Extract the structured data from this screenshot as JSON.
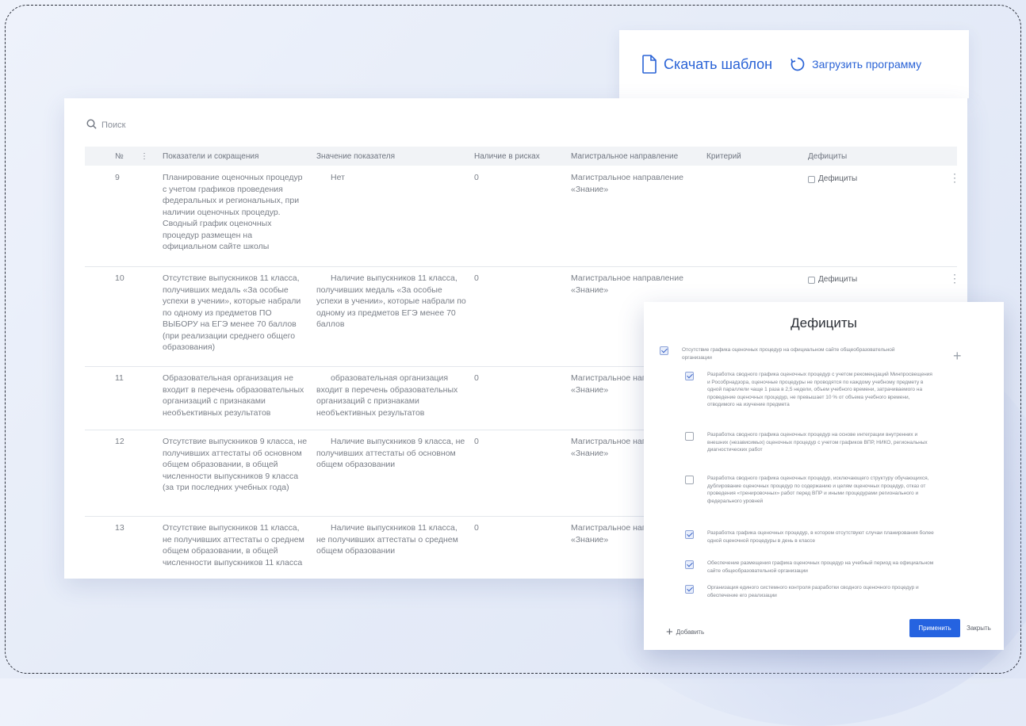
{
  "actions": {
    "download_template": "Скачать шаблон",
    "upload_program": "Загрузить программу"
  },
  "search": {
    "placeholder": "Поиск"
  },
  "table": {
    "headers": {
      "num": "№",
      "indicators": "Показатели и сокращения",
      "value": "Значение показателя",
      "points": "Наличие в рисках",
      "direction": "Магистральное направление",
      "criterion": "Критерий",
      "deficits": "Дефициты"
    },
    "rows": [
      {
        "num": "9",
        "indicator": "Планирование оценочных процедур с учетом графиков проведения федеральных и региональных, при наличии оценочных процедур. Сводный график оценочных процедур размещен на официальном сайте школы",
        "value": "Нет",
        "points": "0",
        "direction": "Магистральное направление «Знание»",
        "deficits_label": "Дефициты"
      },
      {
        "num": "10",
        "indicator": "Отсутствие выпускников 11 класса, получивших медаль «За особые успехи в учении», которые набрали по одному из предметов ПО ВЫБОРУ на ЕГЭ менее 70 баллов (при реализации среднего общего образования)",
        "value": "Наличие выпускников 11 класса, получивших медаль «За особые успехи в учении», которые набрали по одному из предметов ЕГЭ менее 70 баллов",
        "points": "0",
        "direction": "Магистральное направление «Знание»",
        "deficits_label": "Дефициты"
      },
      {
        "num": "11",
        "indicator": "Образовательная организация не входит в перечень образовательных организаций с признаками необъективных результатов",
        "value": "образовательная организация входит в перечень образовательных организаций с признаками необъективных результатов",
        "points": "0",
        "direction": "Магистральное направление «Знание»",
        "deficits_label": ""
      },
      {
        "num": "12",
        "indicator": "Отсутствие выпускников 9 класса, не получивших аттестаты об основном общем образовании, в общей численности выпускников 9 класса (за три последних учебных года)",
        "value": "Наличие выпускников 9 класса, не получивших аттестаты об основном общем образовании",
        "points": "0",
        "direction": "Магистральное направление «Знание»",
        "deficits_label": ""
      },
      {
        "num": "13",
        "indicator": "Отсутствие выпускников 11 класса, не получивших аттестаты о среднем общем образовании, в общей численности выпускников 11 класса",
        "value": "Наличие выпускников 11 класса, не получивших аттестаты о среднем общем образовании",
        "points": "0",
        "direction": "Магистральное направление «Знание»",
        "deficits_label": ""
      }
    ]
  },
  "modal": {
    "title": "Дефициты",
    "items": [
      {
        "checked": true,
        "text": "Отсутствие графика оценочных процедур на официальном сайте общеобразовательной организации"
      },
      {
        "checked": true,
        "text": "Разработка сводного графика оценочных процедур с учетом рекомендаций Минпросвещения и Рособрнадзора, оценочные процедуры не проводятся по каждому учебному предмету в одной параллели чаще 1 раза в 2,5 недели, объем учебного времени, затрачиваемого на проведение оценочных процедур, не превышает 10 % от объема учебного времени, отводимого на изучение предмета"
      },
      {
        "checked": false,
        "text": "Разработка сводного графика оценочных процедур на основе интеграции внутренних и внешних (независимых) оценочных процедур с учетом графиков ВПР, НИКО, региональных диагностических работ"
      },
      {
        "checked": false,
        "text": "Разработка сводного графика оценочных процедур, исключающего структуру обучающихся, дублирование оценочных процедур по содержанию и целям оценочных процедур, отказ от проведения «тренировочных» работ перед ВПР и иными процедурами регионального и федерального уровней"
      },
      {
        "checked": true,
        "text": "Разработка графика оценочных процедур, в котором отсутствуют случаи планирования более одной оценочной процедуры в день в классе"
      },
      {
        "checked": true,
        "text": "Обеспечение размещения графика оценочных процедур на учебный период на официальном сайте общеобразовательной организации"
      },
      {
        "checked": true,
        "text": "Организация единого системного контроля разработки сводного оценочного процедур и обеспечение его реализации"
      }
    ],
    "add_label": "Добавить",
    "apply_label": "Применить",
    "close_label": "Закрыть"
  }
}
